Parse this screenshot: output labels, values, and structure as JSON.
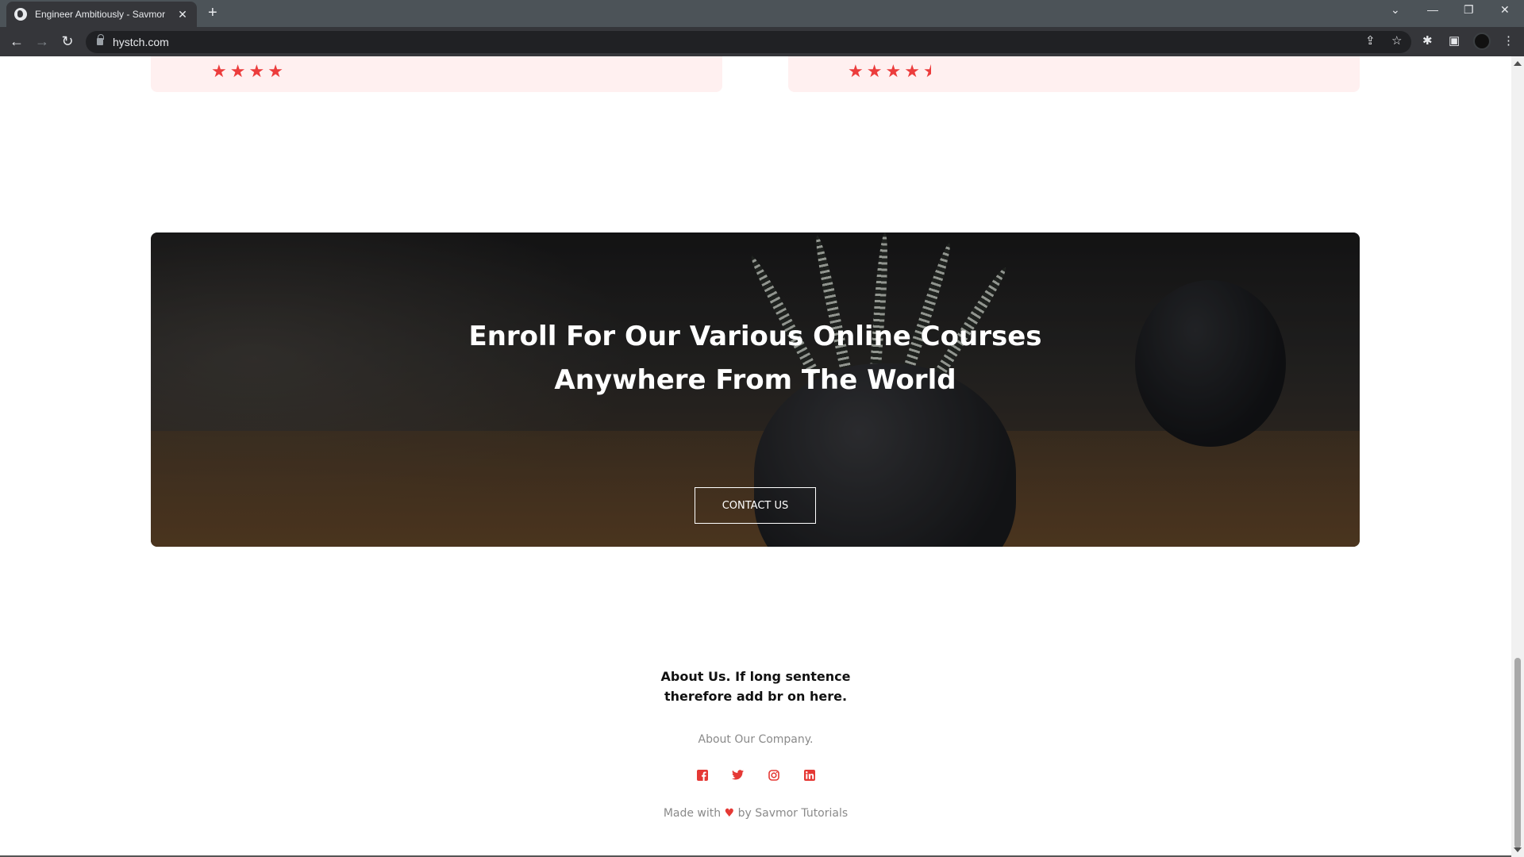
{
  "browser": {
    "tab_title": "Engineer Ambitiously - Savmor",
    "url": "hystch.com"
  },
  "reviews": [
    {
      "rating": 4
    },
    {
      "rating": 4.5
    }
  ],
  "hero": {
    "title_line1": "Enroll For Our Various Online Courses",
    "title_line2": "Anywhere From The World",
    "button_label": "CONTACT US"
  },
  "footer": {
    "heading_line1": "About Us. If long sentence",
    "heading_line2": "therefore add br on here.",
    "subtext": "About Our Company.",
    "social": [
      "facebook-icon",
      "twitter-icon",
      "instagram-icon",
      "linkedin-icon"
    ],
    "made_with_prefix": "Made with",
    "made_with_suffix": "by Savmor Tutorials"
  },
  "colors": {
    "accent": "#e53935",
    "card_bg": "#fff0f0"
  }
}
